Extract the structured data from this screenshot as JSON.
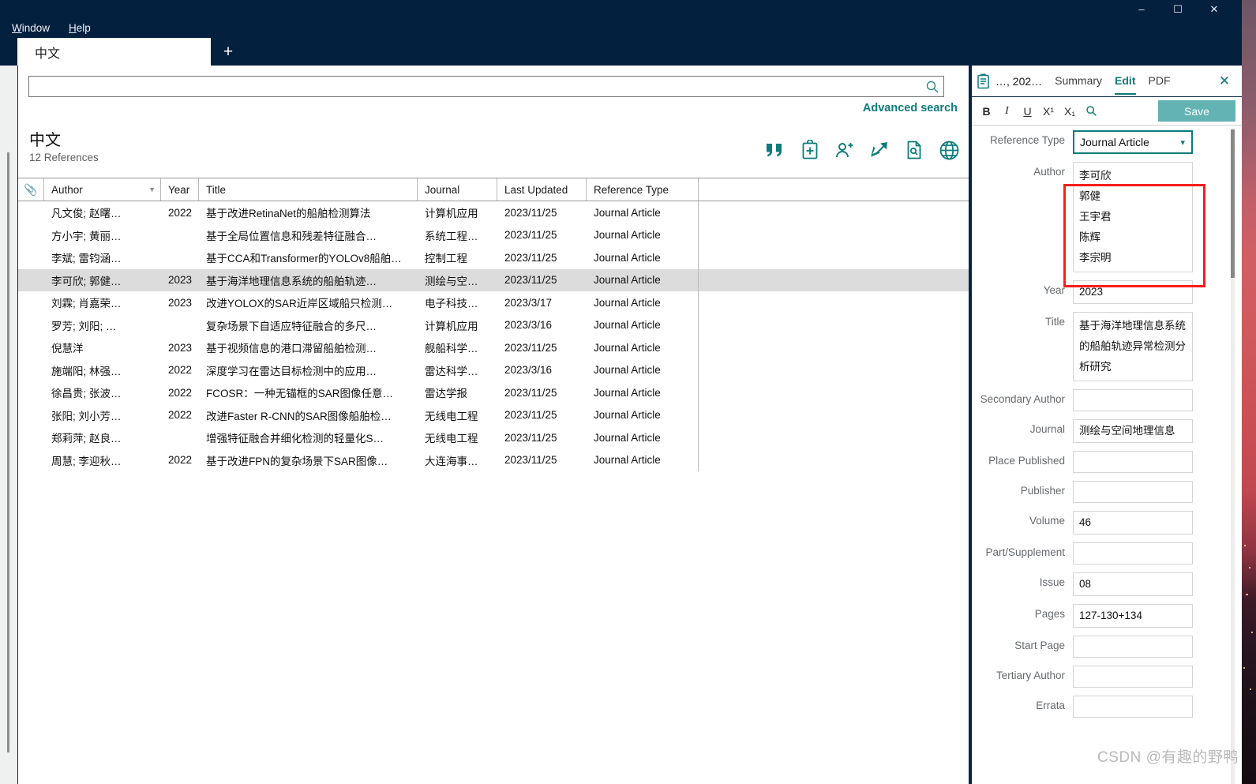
{
  "window": {
    "minimize_label": "–",
    "maximize_label": "☐",
    "close_label": "✕"
  },
  "menubar": {
    "items": [
      {
        "mnemonic": "W",
        "rest": "indow"
      },
      {
        "mnemonic": "H",
        "rest": "elp"
      }
    ]
  },
  "tabstrip": {
    "active_tab": "中文",
    "new_tab_label": "+"
  },
  "search": {
    "value": "",
    "placeholder": "",
    "icon": "search-icon",
    "advanced_label": "Advanced search"
  },
  "group": {
    "title": "中文",
    "count_label": "12 References",
    "tools": [
      {
        "name": "insert-citation-icon",
        "title": "Insert Citation"
      },
      {
        "name": "copy-to-clipboard-icon",
        "title": "Copy to Clipboard"
      },
      {
        "name": "add-author-icon",
        "title": "Share"
      },
      {
        "name": "export-icon",
        "title": "Export"
      },
      {
        "name": "find-full-text-icon",
        "title": "Find Full Text"
      },
      {
        "name": "open-url-icon",
        "title": "Open URL"
      }
    ]
  },
  "table": {
    "columns": [
      {
        "key": "attach",
        "label": "",
        "icon": "paperclip-icon"
      },
      {
        "key": "author",
        "label": "Author",
        "sorted": true
      },
      {
        "key": "year",
        "label": "Year"
      },
      {
        "key": "title",
        "label": "Title"
      },
      {
        "key": "journal",
        "label": "Journal"
      },
      {
        "key": "updated",
        "label": "Last Updated"
      },
      {
        "key": "reftype",
        "label": "Reference Type"
      }
    ],
    "rows": [
      {
        "author": "凡文俊; 赵曙…",
        "year": "2022",
        "title": "基于改进RetinaNet的船舶检测算法",
        "journal": "计算机应用",
        "updated": "2023/11/25",
        "reftype": "Journal Article",
        "selected": false
      },
      {
        "author": "方小宇; 黄丽…",
        "year": "",
        "title": "基于全局位置信息和残差特征融合…",
        "journal": "系统工程…",
        "updated": "2023/11/25",
        "reftype": "Journal Article",
        "selected": false
      },
      {
        "author": "李斌; 雷钧涵…",
        "year": "",
        "title": "基于CCA和Transformer的YOLOv8船舶…",
        "journal": "控制工程",
        "updated": "2023/11/25",
        "reftype": "Journal Article",
        "selected": false
      },
      {
        "author": "李可欣; 郭健…",
        "year": "2023",
        "title": "基于海洋地理信息系统的船舶轨迹…",
        "journal": "测绘与空…",
        "updated": "2023/11/25",
        "reftype": "Journal Article",
        "selected": true
      },
      {
        "author": "刘霖; 肖嘉荣…",
        "year": "2023",
        "title": "改进YOLOX的SAR近岸区域船只检测…",
        "journal": "电子科技…",
        "updated": "2023/3/17",
        "reftype": "Journal Article",
        "selected": false
      },
      {
        "author": "罗芳; 刘阳; …",
        "year": "",
        "title": "复杂场景下自适应特征融合的多尺…",
        "journal": "计算机应用",
        "updated": "2023/3/16",
        "reftype": "Journal Article",
        "selected": false
      },
      {
        "author": "倪慧洋",
        "year": "2023",
        "title": "基于视频信息的港口滞留船舶检测…",
        "journal": "舰船科学…",
        "updated": "2023/11/25",
        "reftype": "Journal Article",
        "selected": false
      },
      {
        "author": "施端阳; 林强…",
        "year": "2022",
        "title": "深度学习在雷达目标检测中的应用…",
        "journal": "雷达科学…",
        "updated": "2023/3/16",
        "reftype": "Journal Article",
        "selected": false
      },
      {
        "author": "徐昌贵; 张波…",
        "year": "2022",
        "title": "FCOSR：一种无锚框的SAR图像任意…",
        "journal": "雷达学报",
        "updated": "2023/11/25",
        "reftype": "Journal Article",
        "selected": false
      },
      {
        "author": "张阳; 刘小芳…",
        "year": "2022",
        "title": "改进Faster R-CNN的SAR图像船舶检…",
        "journal": "无线电工程",
        "updated": "2023/11/25",
        "reftype": "Journal Article",
        "selected": false
      },
      {
        "author": "郑莉萍; 赵良…",
        "year": "",
        "title": "增强特征融合并细化检测的轻量化S…",
        "journal": "无线电工程",
        "updated": "2023/11/25",
        "reftype": "Journal Article",
        "selected": false
      },
      {
        "author": "周慧; 李迎秋…",
        "year": "2022",
        "title": "基于改进FPN的复杂场景下SAR图像…",
        "journal": "大连海事…",
        "updated": "2023/11/25",
        "reftype": "Journal Article",
        "selected": false
      }
    ]
  },
  "right_panel": {
    "breadcrumb": "…, 202…",
    "tabs": [
      {
        "label": "Summary",
        "active": false
      },
      {
        "label": "Edit",
        "active": true
      },
      {
        "label": "PDF",
        "active": false
      }
    ],
    "close_label": "✕",
    "toolbar": {
      "bold": "B",
      "italic": "I",
      "underline": "U",
      "superscript": "X¹",
      "subscript": "X₁",
      "save_label": "Save"
    },
    "fields": [
      {
        "label": "Reference Type",
        "value": "Journal Article",
        "type": "select"
      },
      {
        "label": "Author",
        "value": "李可欣\n郭健\n王宇君\n陈辉\n李宗明",
        "type": "multiline",
        "highlighted": true
      },
      {
        "label": "Year",
        "value": "2023",
        "type": "text"
      },
      {
        "label": "Title",
        "value": "基于海洋地理信息系统的船舶轨迹异常检测分析研究",
        "type": "textarea"
      },
      {
        "label": "Secondary Author",
        "value": "",
        "type": "text"
      },
      {
        "label": "Journal",
        "value": "测绘与空间地理信息",
        "type": "text"
      },
      {
        "label": "Place Published",
        "value": "",
        "type": "text"
      },
      {
        "label": "Publisher",
        "value": "",
        "type": "text"
      },
      {
        "label": "Volume",
        "value": "46",
        "type": "text"
      },
      {
        "label": "Part/Supplement",
        "value": "",
        "type": "text"
      },
      {
        "label": "Issue",
        "value": "08",
        "type": "text"
      },
      {
        "label": "Pages",
        "value": "127-130+134",
        "type": "text"
      },
      {
        "label": "Start Page",
        "value": "",
        "type": "text"
      },
      {
        "label": "Tertiary Author",
        "value": "",
        "type": "text"
      },
      {
        "label": "Errata",
        "value": "",
        "type": "text"
      }
    ]
  },
  "watermark": "CSDN @有趣的野鸭",
  "colors": {
    "window_chrome": "#04203f",
    "accent_teal": "#0f7b7b",
    "save_button": "#64b3b3",
    "selection_row": "#dcdcdc",
    "highlight_red": "#fb1d1d"
  }
}
